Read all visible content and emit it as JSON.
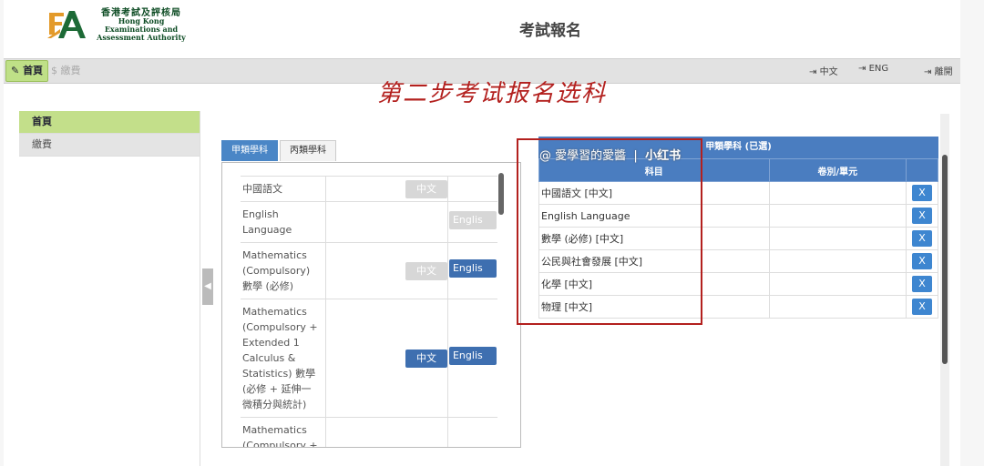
{
  "header": {
    "logo_cn": "香港考試及評核局",
    "logo_en_1": "Hong Kong",
    "logo_en_2": "Examinations and",
    "logo_en_3": "Assessment Authority",
    "title": "考試報名"
  },
  "topbar": {
    "home_label": "首頁",
    "pay_label": "繳費",
    "lang_zh": "中文",
    "lang_en": "ENG",
    "logout": "離開"
  },
  "annotation": "第二步考试报名选科",
  "sidebar": {
    "items": [
      {
        "label": "首頁"
      },
      {
        "label": "繳費"
      }
    ]
  },
  "tabs": [
    {
      "label": "甲類學科"
    },
    {
      "label": "丙類學科"
    }
  ],
  "subjects": [
    {
      "name": "中國語文",
      "cn": "中文",
      "en": ""
    },
    {
      "name": "English Language",
      "cn": "",
      "en": "Englis"
    },
    {
      "name": "Mathematics (Compulsory) 數學 (必修)",
      "cn": "中文",
      "en": "Englis"
    },
    {
      "name": "Mathematics (Compulsory + Extended 1 Calculus & Statistics) 數學 (必修 + 延伸一 微積分與統計)",
      "cn": "中文",
      "en": "Englis"
    },
    {
      "name": "Mathematics (Compulsory + E",
      "cn": "",
      "en": ""
    }
  ],
  "selected": {
    "heading": "甲類學科 (已選)",
    "col_subject": "科目",
    "col_paper": "卷別/單元",
    "remove_label": "X",
    "rows": [
      {
        "subject": "中國語文 [中文]"
      },
      {
        "subject": "English Language"
      },
      {
        "subject": "數學 (必修) [中文]"
      },
      {
        "subject": "公民與社會發展 [中文]"
      },
      {
        "subject": "化學 [中文]"
      },
      {
        "subject": "物理 [中文]"
      }
    ]
  },
  "watermark": {
    "handle": "@ 愛學習的愛醬",
    "platform": "小红书"
  },
  "colors": {
    "accent_blue": "#4a7dc0",
    "active_green": "#c3df8a",
    "annotation_red": "#b3201e"
  }
}
